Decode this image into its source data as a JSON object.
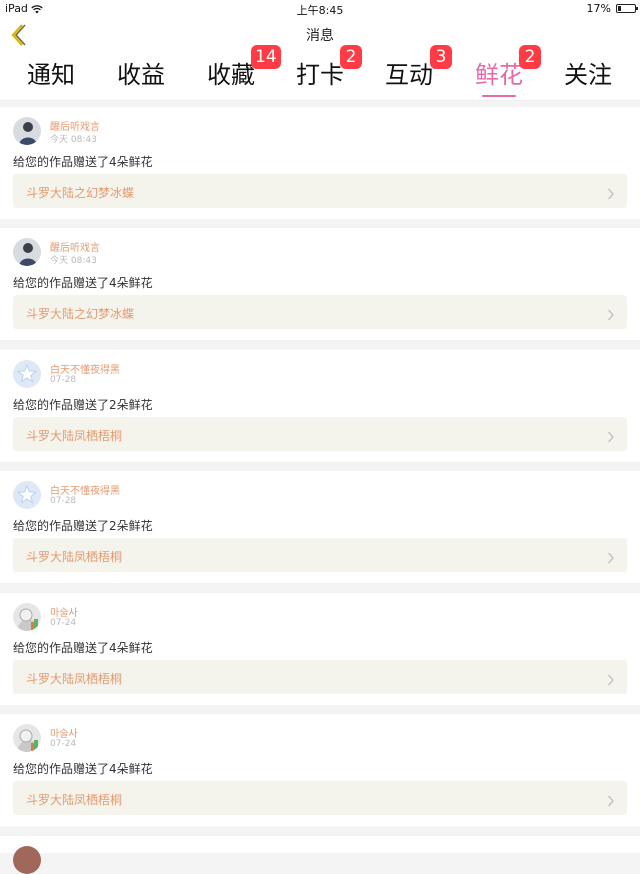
{
  "status_bar": {
    "carrier": "iPad",
    "time": "上午8:45",
    "battery": "17%",
    "battery_level": 0.17
  },
  "nav": {
    "title": "消息",
    "back_icon": "chevron-left-icon"
  },
  "colors": {
    "accent_pink": "#e56aa6",
    "badge_red": "#ff3b46",
    "name_orange": "#e39a70",
    "link_bg": "#f5f4ec"
  },
  "tabs": [
    {
      "label": "通知",
      "badge": null
    },
    {
      "label": "收益",
      "badge": null
    },
    {
      "label": "收藏",
      "badge": "14"
    },
    {
      "label": "打卡",
      "badge": "2"
    },
    {
      "label": "互动",
      "badge": "3"
    },
    {
      "label": "鲜花",
      "badge": "2",
      "active": true
    },
    {
      "label": "关注",
      "badge": null
    }
  ],
  "messages": [
    {
      "user": "醒后听戏言",
      "time": "今天 08:43",
      "text": "给您的作品赠送了4朵鲜花",
      "work": "斗罗大陆之幻梦冰蝶"
    },
    {
      "user": "醒后听戏言",
      "time": "今天 08:43",
      "text": "给您的作品赠送了4朵鲜花",
      "work": "斗罗大陆之幻梦冰蝶"
    },
    {
      "user": "白天不懂夜得黑",
      "time": "07-28",
      "text": "给您的作品赠送了2朵鲜花",
      "work": "斗罗大陆凤栖梧桐"
    },
    {
      "user": "白天不懂夜得黑",
      "time": "07-28",
      "text": "给您的作品赠送了2朵鲜花",
      "work": "斗罗大陆凤栖梧桐"
    },
    {
      "user": "마술사",
      "time": "07-24",
      "text": "给您的作品赠送了4朵鲜花",
      "work": "斗罗大陆凤栖梧桐"
    },
    {
      "user": "마술사",
      "time": "07-24",
      "text": "给您的作品赠送了4朵鲜花",
      "work": "斗罗大陆凤栖梧桐"
    }
  ]
}
